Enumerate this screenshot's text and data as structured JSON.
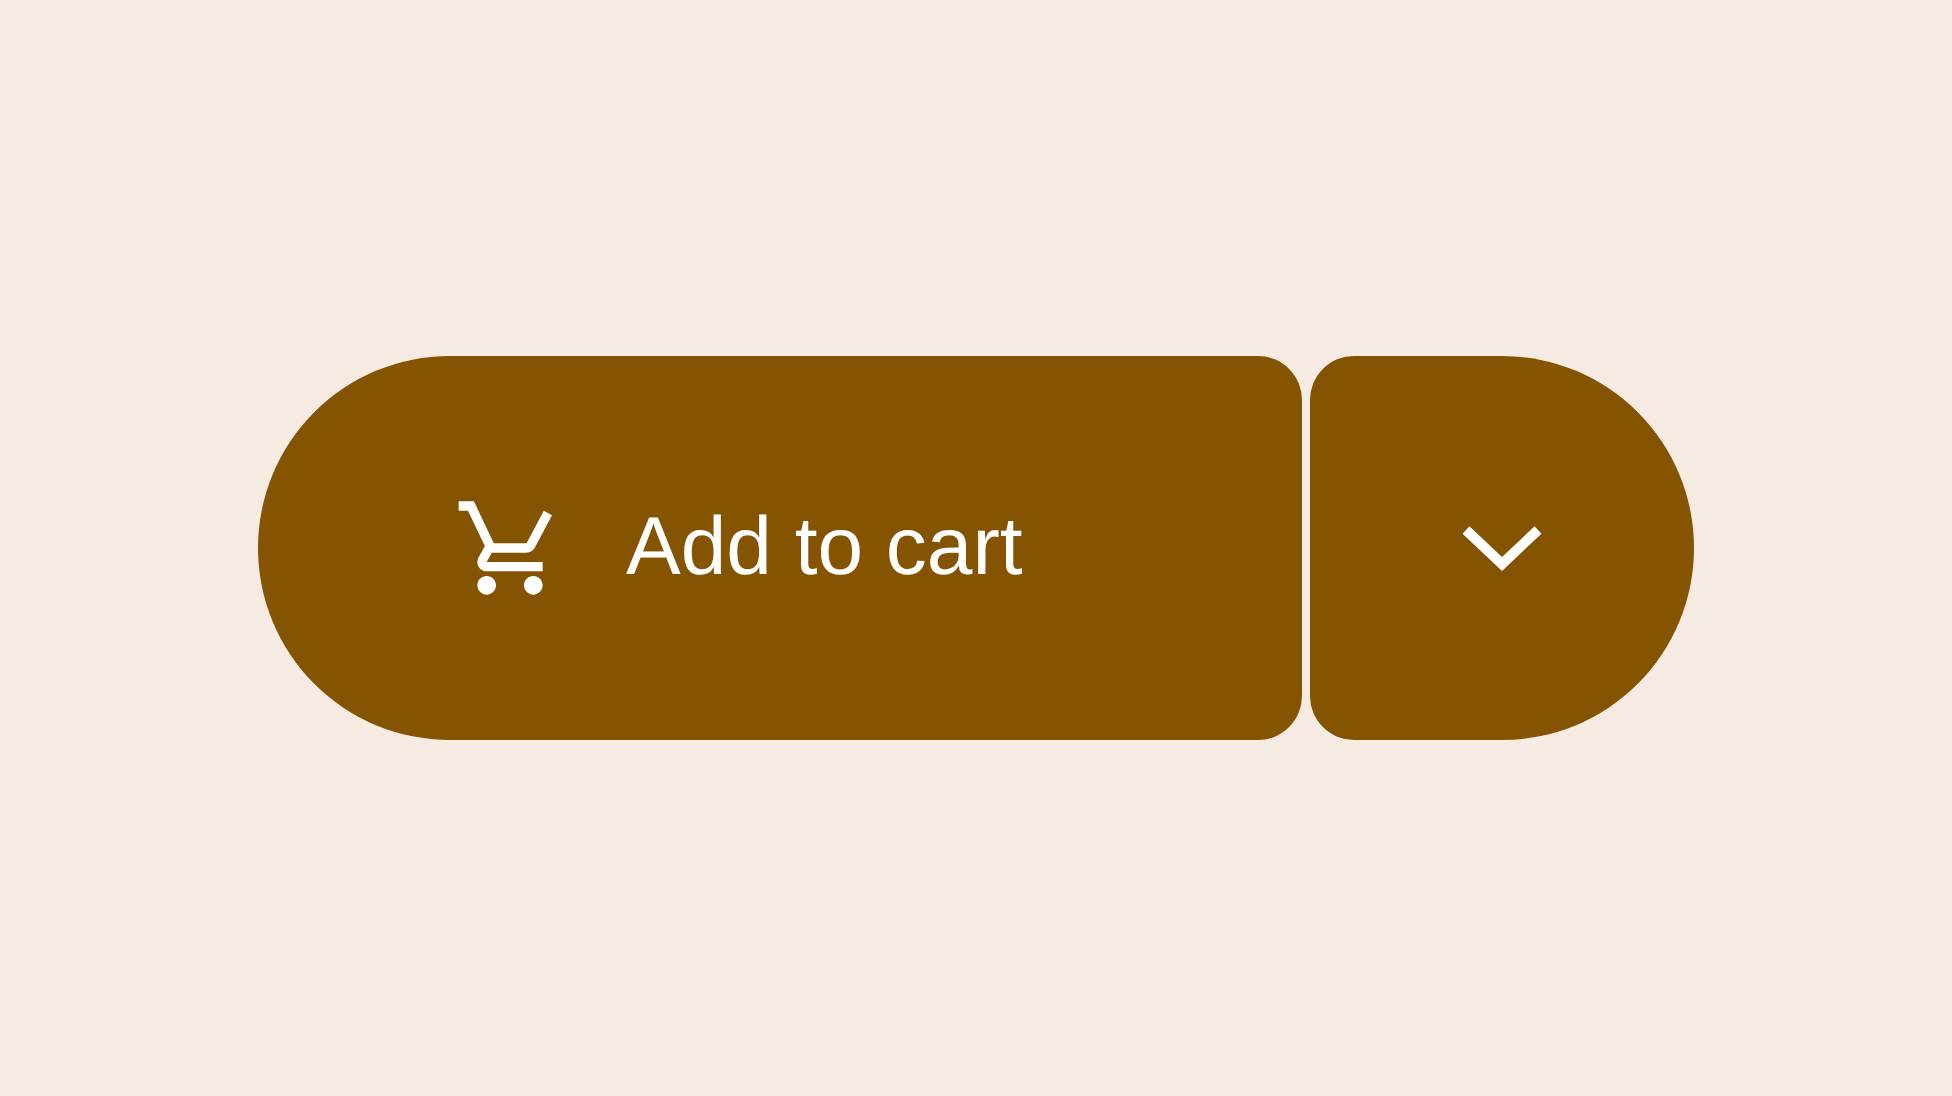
{
  "split_button": {
    "label": "Add to cart"
  }
}
